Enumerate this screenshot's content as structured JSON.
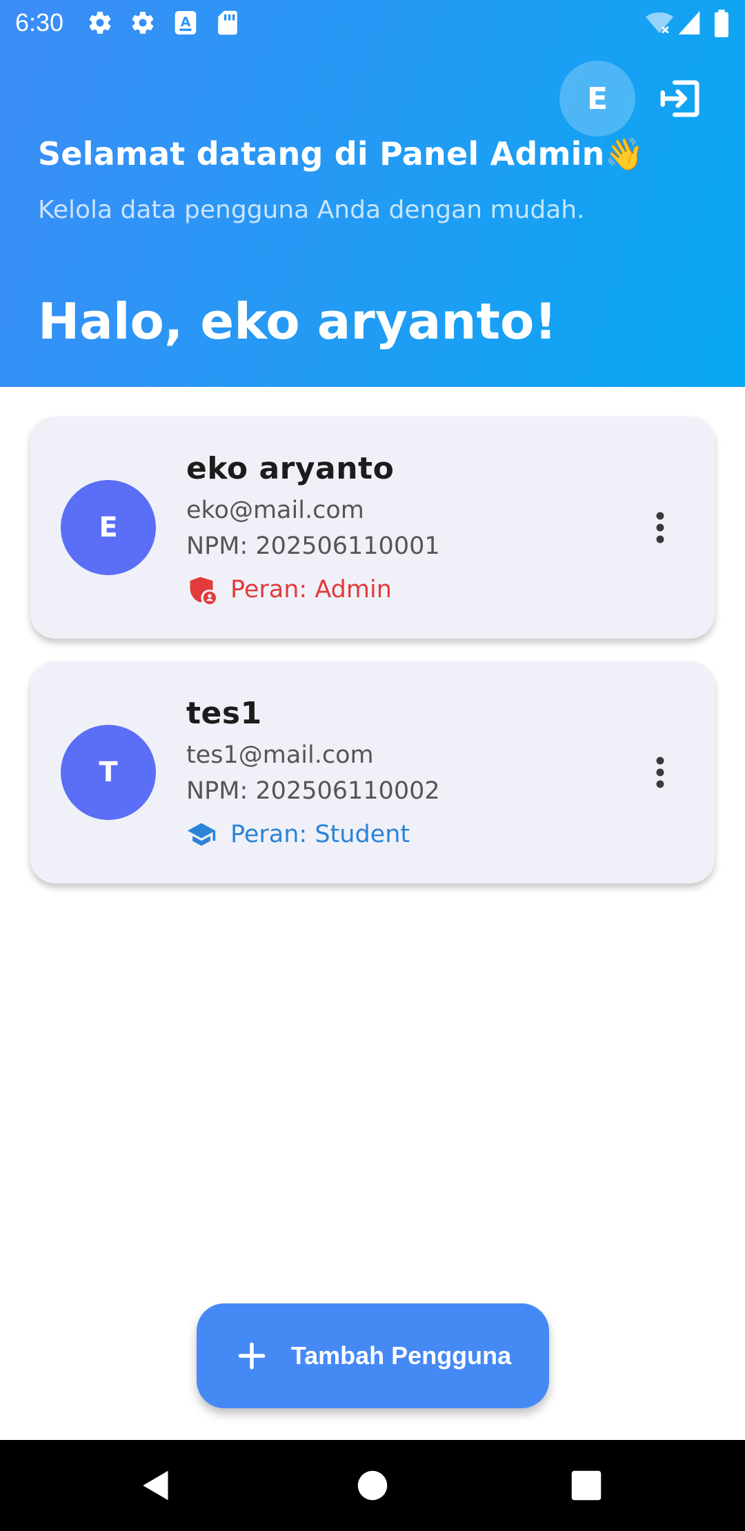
{
  "status_bar": {
    "time": "6:30",
    "icons": [
      "settings-icon",
      "settings-icon",
      "keyboard-icon",
      "sd-card-icon",
      "wifi-icon",
      "signal-icon",
      "battery-icon"
    ]
  },
  "header": {
    "avatar_initial": "E",
    "logout_icon": "logout-icon",
    "welcome_title": "Selamat datang di Panel Admin👋",
    "welcome_subtitle": "Kelola data pengguna Anda dengan mudah.",
    "greeting": "Halo, eko aryanto!"
  },
  "users": [
    {
      "initial": "E",
      "name": "eko aryanto",
      "email": "eko@mail.com",
      "npm": "NPM: 202506110001",
      "role": "Peran: Admin",
      "role_icon": "admin-shield-icon",
      "role_color": "#e23b3b"
    },
    {
      "initial": "T",
      "name": "tes1",
      "email": "tes1@mail.com",
      "npm": "NPM: 202506110002",
      "role": "Peran: Student",
      "role_icon": "graduation-cap-icon",
      "role_color": "#2b83d8"
    }
  ],
  "fab": {
    "label": "Tambah Pengguna",
    "icon": "plus-icon"
  },
  "colors": {
    "header_gradient_start": "#3d8cf7",
    "header_gradient_end": "#07a8f2",
    "avatar": "#5b6ef6",
    "card_background": "#f0f1f8",
    "fab": "#4589f5"
  },
  "nav_bar": {
    "buttons": [
      "back-icon",
      "home-icon",
      "recents-icon"
    ]
  }
}
